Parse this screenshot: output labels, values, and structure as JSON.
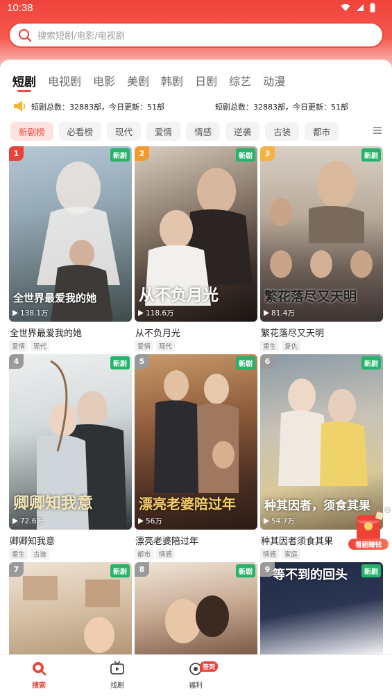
{
  "status_bar": {
    "time": "10:38"
  },
  "search": {
    "placeholder": "搜索短剧/电影/电视剧"
  },
  "tabs": [
    {
      "label": "短剧",
      "active": true
    },
    {
      "label": "电视剧"
    },
    {
      "label": "电影"
    },
    {
      "label": "美剧"
    },
    {
      "label": "韩剧"
    },
    {
      "label": "日剧"
    },
    {
      "label": "综艺"
    },
    {
      "label": "动漫"
    }
  ],
  "stats": {
    "text_1": "短剧总数：32883部，今日更新：51部",
    "text_2": "短剧总数：32883部，今日更新：51部"
  },
  "filters": [
    "新剧榜",
    "必看榜",
    "现代",
    "爱情",
    "情感",
    "逆袭",
    "古装",
    "都市"
  ],
  "new_badge": "新剧",
  "dramas": [
    {
      "rank": "1",
      "title": "全世界最爱我的她",
      "poster_text": "全世界最爱我的她",
      "views": "138.1万",
      "tags": [
        "爱情",
        "现代"
      ]
    },
    {
      "rank": "2",
      "title": "从不负月光",
      "poster_text": "从不负月光",
      "views": "118.6万",
      "tags": [
        "爱情",
        "现代"
      ]
    },
    {
      "rank": "3",
      "title": "繁花落尽又天明",
      "poster_text": "繁花落尽又天明",
      "views": "81.4万",
      "tags": [
        "重生",
        "复仇"
      ]
    },
    {
      "rank": "4",
      "title": "卿卿知我意",
      "poster_text": "卿卿知我意",
      "views": "72.6万",
      "tags": [
        "重生",
        "古装"
      ]
    },
    {
      "rank": "5",
      "title": "漂亮老婆陪过年",
      "poster_text": "漂亮老婆陪过年",
      "views": "56万",
      "tags": [
        "都市",
        "情感"
      ]
    },
    {
      "rank": "6",
      "title": "种其因者须食其果",
      "poster_text": "种其因者，须食其果",
      "views": "54.7万",
      "tags": [
        "情感",
        "家庭"
      ]
    },
    {
      "rank": "7",
      "title": "",
      "poster_text": "",
      "views": "",
      "tags": []
    },
    {
      "rank": "8",
      "title": "",
      "poster_text": "",
      "views": "",
      "tags": []
    },
    {
      "rank": "9",
      "title": "",
      "poster_text": "等不到的回头",
      "views": "",
      "tags": []
    }
  ],
  "fab": {
    "label": "看剧赚钱"
  },
  "bottom_nav": [
    {
      "label": "搜索",
      "icon": "search-icon",
      "active": true
    },
    {
      "label": "找剧",
      "icon": "tv-icon"
    },
    {
      "label": "福利",
      "icon": "gift-icon",
      "badge": "签到"
    }
  ],
  "colors": {
    "accent": "#e8493e",
    "new_badge": "#24b36b"
  }
}
